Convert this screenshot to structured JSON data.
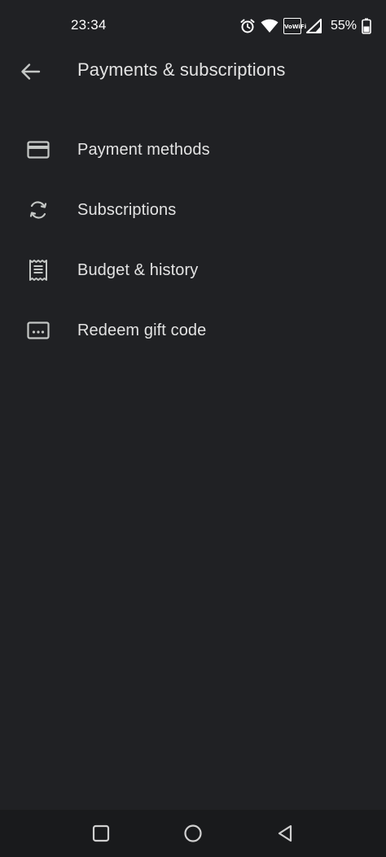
{
  "status_bar": {
    "time": "23:34",
    "battery_percent": "55%",
    "vowifi_top": "Vo",
    "vowifi_bottom": "WiFi",
    "icons": [
      "alarm-icon",
      "wifi-icon",
      "vowifi-icon",
      "cellular-signal-icon",
      "battery-icon"
    ]
  },
  "app_bar": {
    "back_icon": "arrow-back-icon",
    "title": "Payments & subscriptions"
  },
  "menu": {
    "items": [
      {
        "label": "Payment methods",
        "icon": "credit-card-icon"
      },
      {
        "label": "Subscriptions",
        "icon": "sync-icon"
      },
      {
        "label": "Budget & history",
        "icon": "receipt-icon"
      },
      {
        "label": "Redeem gift code",
        "icon": "redeem-code-icon"
      }
    ]
  },
  "nav_bar": {
    "buttons": [
      "recents-square-icon",
      "home-circle-icon",
      "back-triangle-icon"
    ]
  },
  "colors": {
    "background": "#202124",
    "text_primary": "#e3e3e3",
    "icon": "#c4c7c5",
    "nav_bar": "#191a1c"
  }
}
